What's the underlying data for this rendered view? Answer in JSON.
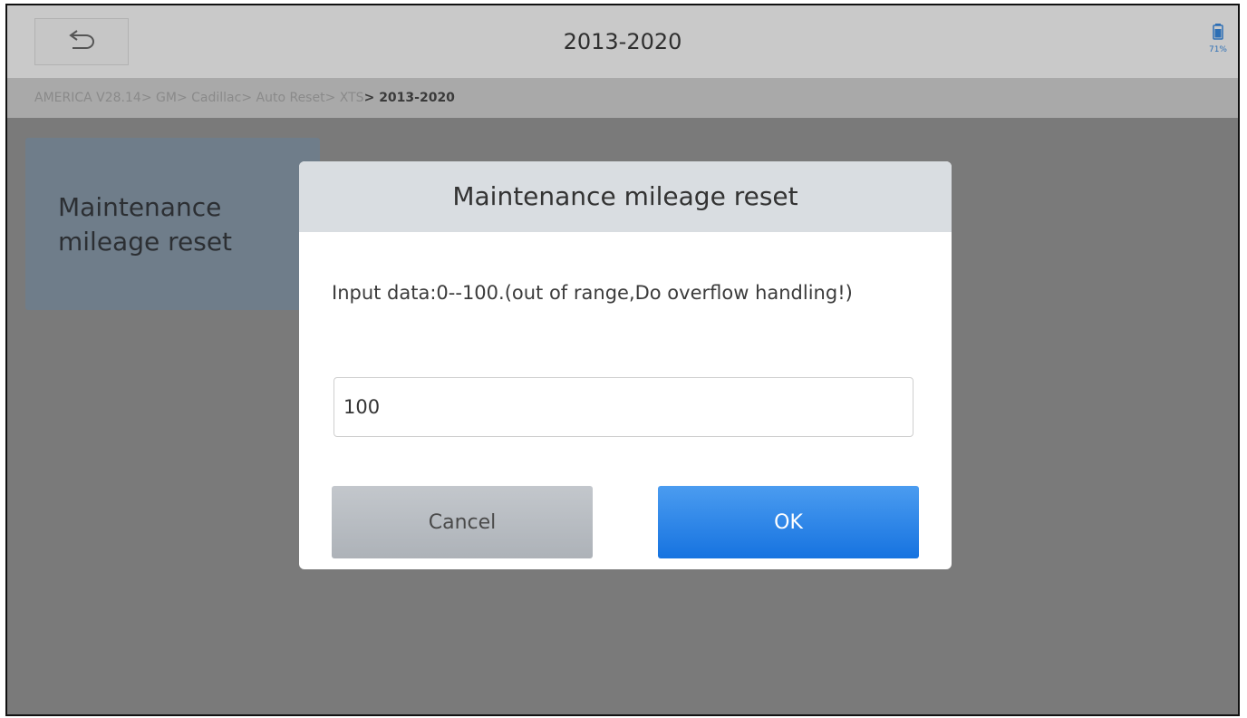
{
  "header": {
    "title": "2013-2020",
    "battery_percent": "71%",
    "back_icon": "back-arrow-icon"
  },
  "breadcrumb": {
    "items": [
      "AMERICA V28.14",
      "GM",
      "Cadillac",
      "Auto Reset",
      "XTS"
    ],
    "current": "2013-2020",
    "separator": "> "
  },
  "menu": {
    "tile_label": "Maintenance mileage reset"
  },
  "dialog": {
    "title": "Maintenance mileage reset",
    "message": "Input data:0--100.(out of range,Do overflow handling!)",
    "input_value": "100",
    "cancel_label": "Cancel",
    "ok_label": "OK"
  },
  "colors": {
    "accent": "#1673e0",
    "overlay": "#7a7a7a",
    "battery": "#2d6fb5"
  }
}
